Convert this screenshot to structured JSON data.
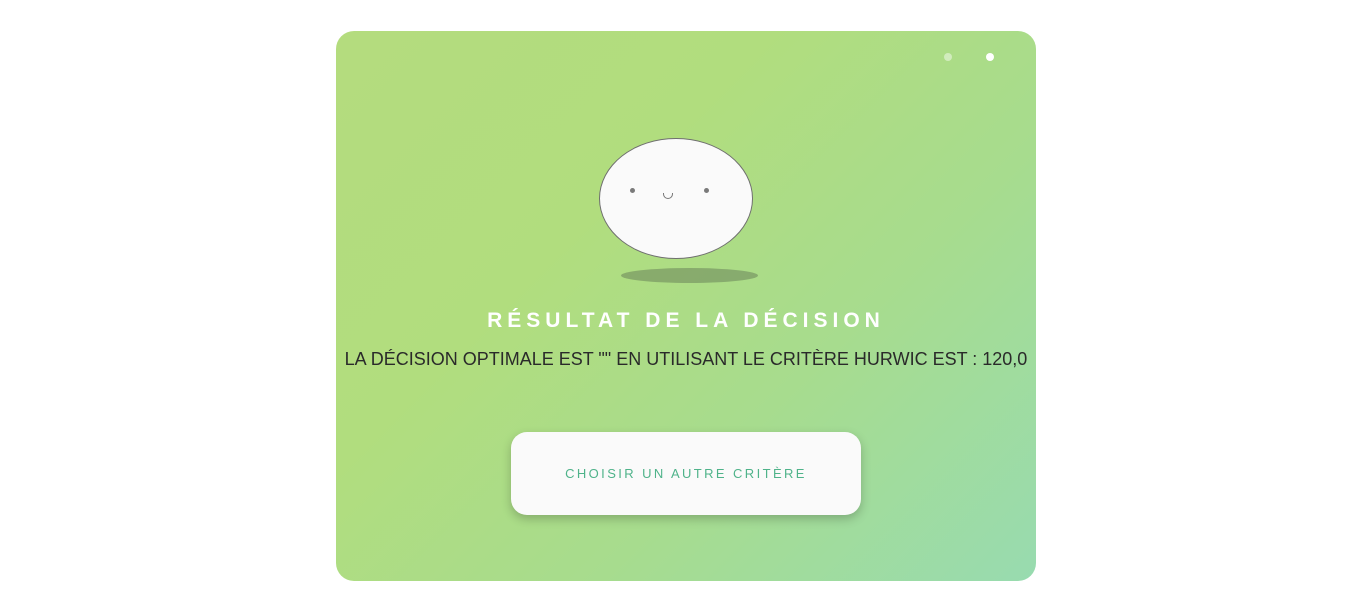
{
  "carousel": {
    "dots": [
      {
        "active": false
      },
      {
        "active": true
      }
    ]
  },
  "result": {
    "title": "RÉSULTAT DE LA DÉCISION",
    "message": "LA DÉCISION OPTIMALE EST \"\" EN UTILISANT LE CRITÈRE HURWIC EST : 120,0"
  },
  "actions": {
    "choose_other_label": "CHOISIR UN AUTRE CRITÈRE"
  },
  "colors": {
    "card_gradient_start": "#b4dc7e",
    "card_gradient_end": "#98dbb0",
    "button_text": "#4fb38a",
    "title_text": "#ffffff"
  },
  "icons": {
    "mascot": "smiling-blob-icon"
  }
}
